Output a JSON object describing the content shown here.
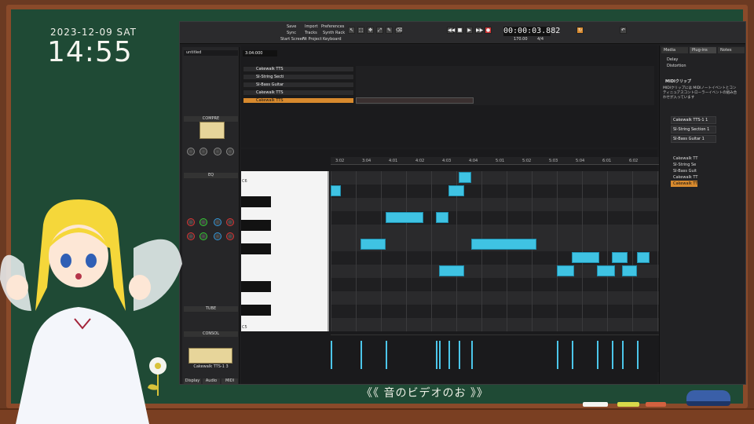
{
  "clock": {
    "date": "2023-12-09 SAT",
    "time": "14:55"
  },
  "caption": "《《 音のビデオのお 》》",
  "colors": {
    "board": "#1f4a35",
    "frame": "#8a4a2a",
    "note": "#3fc3e3",
    "accent": "#d88a2e"
  },
  "daw": {
    "menu": {
      "save": "Save",
      "sync": "Sync",
      "start_screen": "Start Screen",
      "import": "Import",
      "tracks": "Tracks",
      "fit_project": "Fit Project",
      "preferences": "Preferences",
      "synth_rack": "Synth Rack",
      "keyboard": "Keyboard"
    },
    "transport": {
      "time": "00:00:03.882",
      "tempo": "170.00",
      "meter": "4/4"
    },
    "project_name": "untitled",
    "now_time": "3:04:000",
    "tracks": [
      {
        "num": "1",
        "name": "Cakewalk TTS"
      },
      {
        "num": "2",
        "name": "SI-String Secti"
      },
      {
        "num": "3",
        "name": "SI-Bass Guitar"
      },
      {
        "num": "4",
        "name": "Cakewalk TTS"
      },
      {
        "num": "5",
        "name": "Cakewalk TTS"
      }
    ],
    "inspector": {
      "compressor": "COMPRE",
      "eq": "EQ",
      "tube": "TUBE",
      "console": "CONSOL",
      "strip_name": "Cakewalk TTS-1 3",
      "tabs": [
        "Display",
        "Audio",
        "MIDI"
      ]
    },
    "roll": {
      "ruler": [
        "3:02",
        "3:04",
        "4:01",
        "4:02",
        "4:03",
        "4:04",
        "5:01",
        "5:02",
        "5:03",
        "5:04",
        "6:01",
        "6:02"
      ],
      "key_labels": [
        "C6",
        "C5"
      ]
    },
    "browser": {
      "tabs": [
        "Media",
        "Plug-ins",
        "Notes"
      ],
      "items": [
        "Delay",
        "Distortion"
      ],
      "help_title": "MIDIクリップ",
      "help_text": "MIDIクリップには MIDIノートイベントとコンティニュアスコントローラーイベントの組み合わせが入っています",
      "strips": [
        "Cakewalk TTS-1 1",
        "SI-String Section 1",
        "SI-Bass Guitar 1"
      ],
      "mini_tracks": [
        "Cakewalk TT",
        "SI-String Se",
        "SI-Bass Guit",
        "Cakewalk TT",
        "Cakewalk TT"
      ]
    }
  },
  "notes": [
    {
      "pitch_row": 1,
      "start_beat": 0.0,
      "len_beat": 0.4
    },
    {
      "pitch_row": 5,
      "start_beat": 1.2,
      "len_beat": 1.0
    },
    {
      "pitch_row": 7,
      "start_beat": 4.3,
      "len_beat": 1.0
    },
    {
      "pitch_row": 1,
      "start_beat": 4.7,
      "len_beat": 0.6
    },
    {
      "pitch_row": 0,
      "start_beat": 5.1,
      "len_beat": 0.5
    },
    {
      "pitch_row": 3,
      "start_beat": 2.2,
      "len_beat": 1.5
    },
    {
      "pitch_row": 3,
      "start_beat": 4.2,
      "len_beat": 0.5
    },
    {
      "pitch_row": 5,
      "start_beat": 5.6,
      "len_beat": 2.6
    },
    {
      "pitch_row": 7,
      "start_beat": 9.0,
      "len_beat": 0.7
    },
    {
      "pitch_row": 7,
      "start_beat": 10.6,
      "len_beat": 0.7
    },
    {
      "pitch_row": 6,
      "start_beat": 9.6,
      "len_beat": 1.1
    },
    {
      "pitch_row": 6,
      "start_beat": 11.2,
      "len_beat": 0.6
    },
    {
      "pitch_row": 7,
      "start_beat": 11.6,
      "len_beat": 0.6
    },
    {
      "pitch_row": 6,
      "start_beat": 12.2,
      "len_beat": 0.5
    }
  ]
}
